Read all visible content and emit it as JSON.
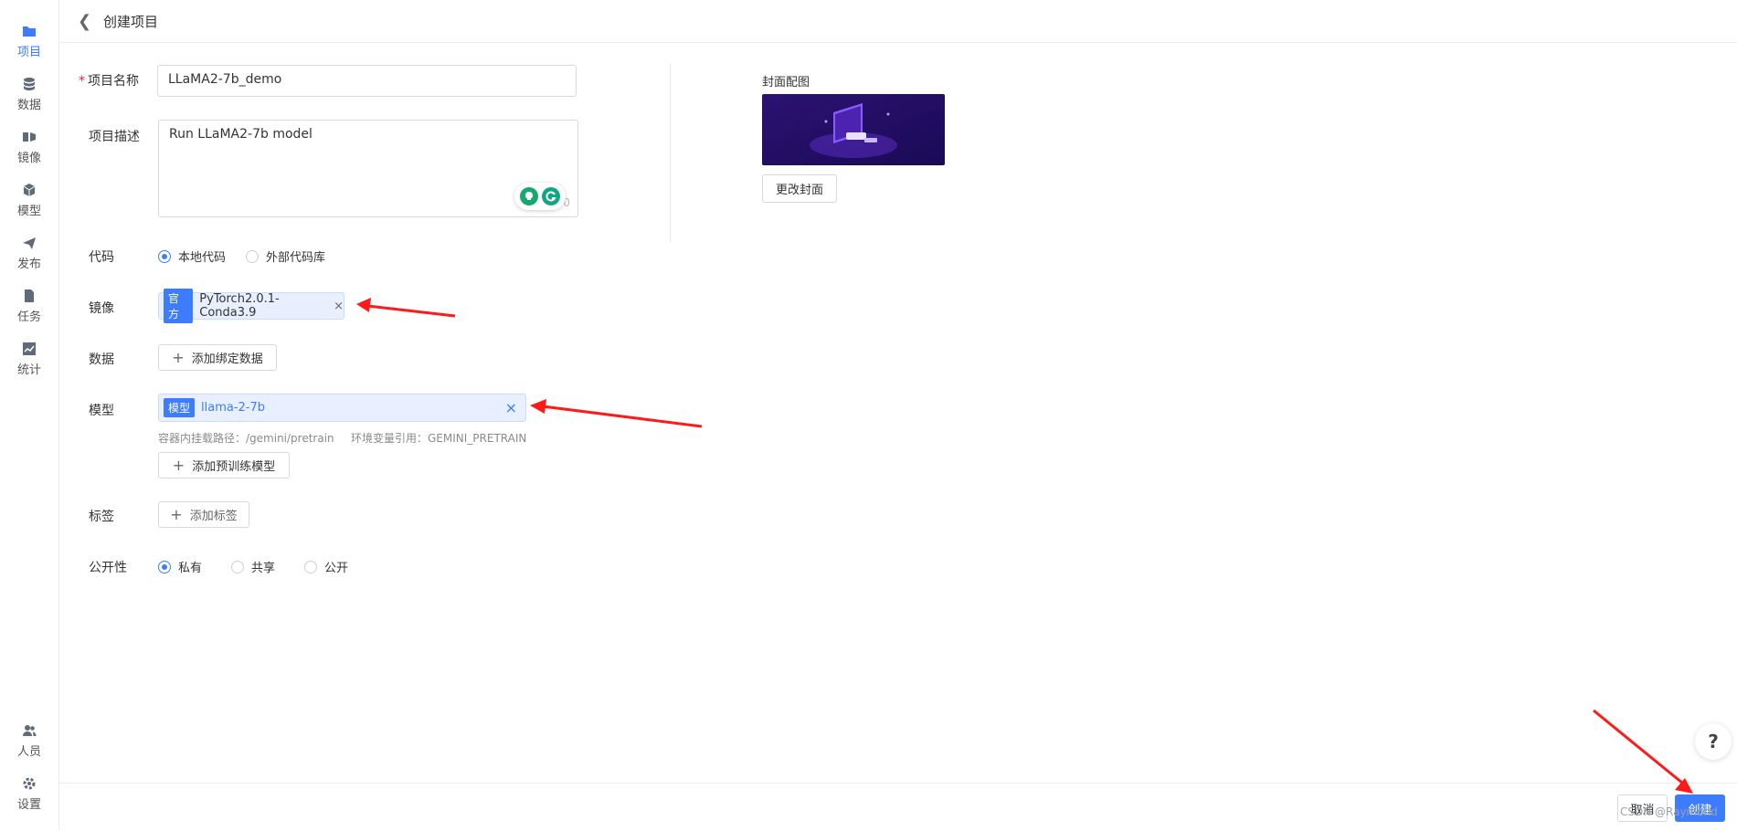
{
  "sidebar": {
    "items": [
      {
        "label": "项目",
        "icon": "folder-icon"
      },
      {
        "label": "数据",
        "icon": "database-icon"
      },
      {
        "label": "镜像",
        "icon": "image-icon"
      },
      {
        "label": "模型",
        "icon": "cube-icon"
      },
      {
        "label": "发布",
        "icon": "send-icon"
      },
      {
        "label": "任务",
        "icon": "task-icon"
      },
      {
        "label": "统计",
        "icon": "chart-icon"
      }
    ],
    "bottom_items": [
      {
        "label": "人员",
        "icon": "users-icon"
      },
      {
        "label": "设置",
        "icon": "gear-icon"
      }
    ]
  },
  "header": {
    "title": "创建项目"
  },
  "form": {
    "name_label": "项目名称",
    "name_value": "LLaMA2-7b_demo",
    "desc_label": "项目描述",
    "desc_value": "Run LLaMA2-7b model",
    "desc_counter": "0",
    "code_label": "代码",
    "code_options": [
      "本地代码",
      "外部代码库"
    ],
    "image_label": "镜像",
    "image_badge": "官方",
    "image_value": "PyTorch2.0.1-Conda3.9",
    "data_label": "数据",
    "data_button": "添加绑定数据",
    "model_label": "模型",
    "model_badge": "模型",
    "model_value": "llama-2-7b",
    "model_path": "容器内挂载路径：/gemini/pretrain",
    "model_env": "环境变量引用：GEMINI_PRETRAIN",
    "model_button": "添加预训练模型",
    "tag_label": "标签",
    "tag_button": "添加标签",
    "visibility_label": "公开性",
    "visibility_options": [
      "私有",
      "共享",
      "公开"
    ]
  },
  "cover": {
    "label": "封面配图",
    "change_button": "更改封面"
  },
  "footer": {
    "cancel": "取消",
    "create": "创建"
  },
  "help": "?",
  "watermark": "CSDN @Raymond",
  "colors": {
    "accent": "#3d7bff",
    "annotation": "#ff1a1a"
  }
}
